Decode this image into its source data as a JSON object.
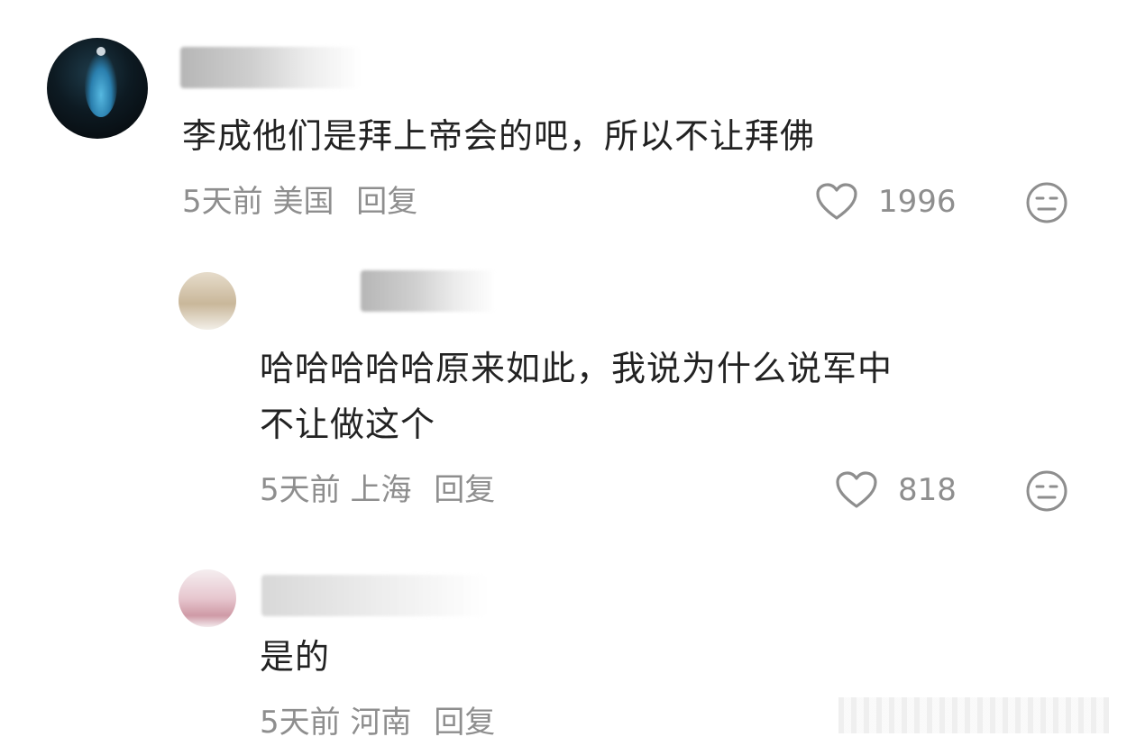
{
  "comments": [
    {
      "text": "李成他们是拜上帝会的吧，所以不让拜佛",
      "time": "5天前",
      "location": "美国",
      "reply_label": "回复",
      "likes": "1996"
    },
    {
      "text_line1": "哈哈哈哈哈原来如此，我说为什么说军中",
      "text_line2": "不让做这个",
      "time": "5天前",
      "location": "上海",
      "reply_label": "回复",
      "likes": "818"
    },
    {
      "text": "是的",
      "time": "5天前",
      "location": "河南",
      "reply_label": "回复"
    }
  ],
  "colors": {
    "text": "#222222",
    "meta": "#8e8e8e",
    "background": "#ffffff"
  },
  "icons": {
    "like": "heart-outline-icon",
    "emoji": "neutral-face-icon"
  }
}
